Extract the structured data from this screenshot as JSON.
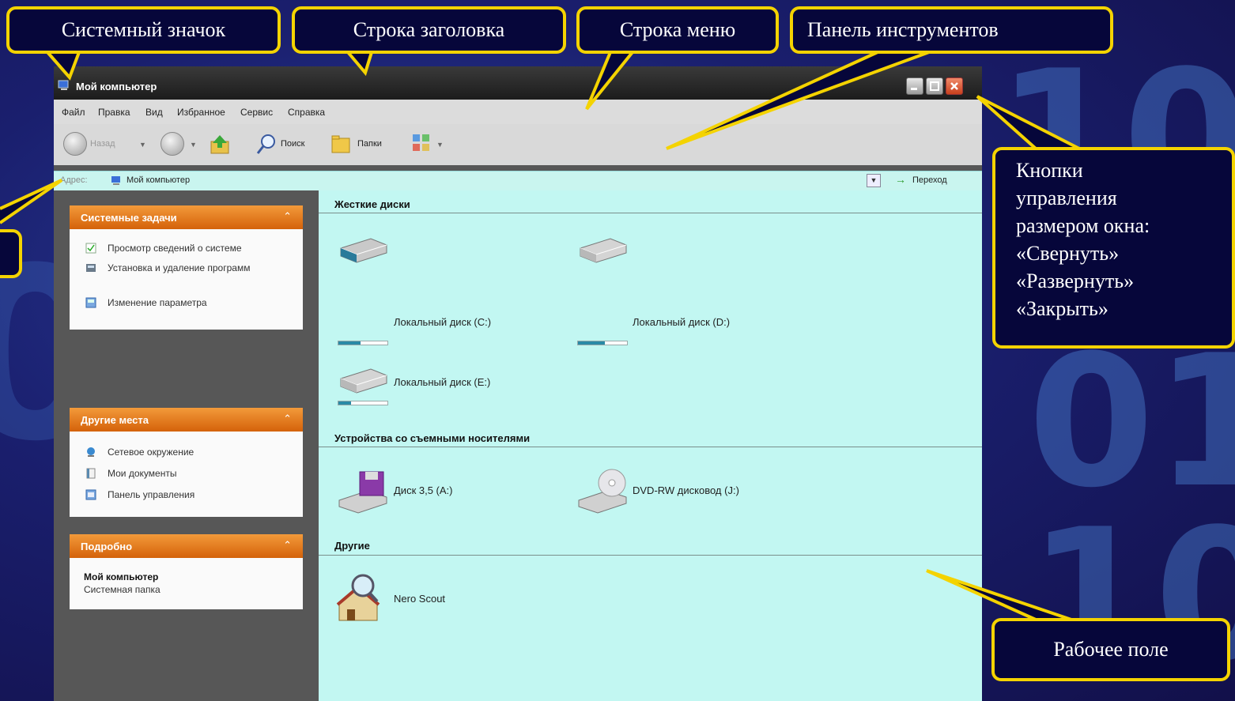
{
  "window": {
    "title": "Мой компьютер",
    "menu": [
      "Файл",
      "Правка",
      "Вид",
      "Избранное",
      "Сервис",
      "Справка"
    ],
    "toolbar": {
      "back_label": "Назад",
      "search_label": "Поиск",
      "folders_label": "Папки"
    },
    "address": {
      "label": "Адрес:",
      "value": "Мой компьютер",
      "go_label": "Переход"
    }
  },
  "left_panel": {
    "system_tasks": {
      "title": "Системные задачи",
      "items": [
        "Просмотр сведений о системе",
        "Установка и удаление программ",
        "Изменение параметра"
      ]
    },
    "other_places": {
      "title": "Другие места",
      "items": [
        "Сетевое окружение",
        "Мои документы",
        "Панель управления"
      ]
    },
    "details": {
      "title": "Подробно",
      "name": "Мой компьютер",
      "type": "Системная папка"
    }
  },
  "workspace": {
    "hard_drives": {
      "title": "Жесткие диски",
      "items": [
        {
          "label": "Локальный диск (C:)",
          "used_fraction": 0.45
        },
        {
          "label": "Локальный диск (D:)",
          "used_fraction": 0.55
        },
        {
          "label": "Локальный диск (E:)",
          "used_fraction": 0.25
        }
      ]
    },
    "removable": {
      "title": "Устройства со съемными носителями",
      "items": [
        "Диск 3,5 (A:)",
        "DVD-RW дисковод (J:)"
      ]
    },
    "other": {
      "title": "Другие",
      "items": [
        "Nero Scout"
      ]
    }
  },
  "callouts": {
    "system_icon": "Системный значок",
    "title_bar": "Строка заголовка",
    "menu_bar": "Строка меню",
    "toolbar": "Панель инструментов",
    "window_buttons": [
      "Кнопки",
      "управления",
      "размером окна:",
      "«Свернуть»",
      "«Развернуть»",
      "«Закрыть»"
    ],
    "workspace": "Рабочее поле"
  },
  "colors": {
    "callout_border": "#f4d300",
    "task_header": "#e07010",
    "workspace_bg": "#c2f7f2"
  }
}
